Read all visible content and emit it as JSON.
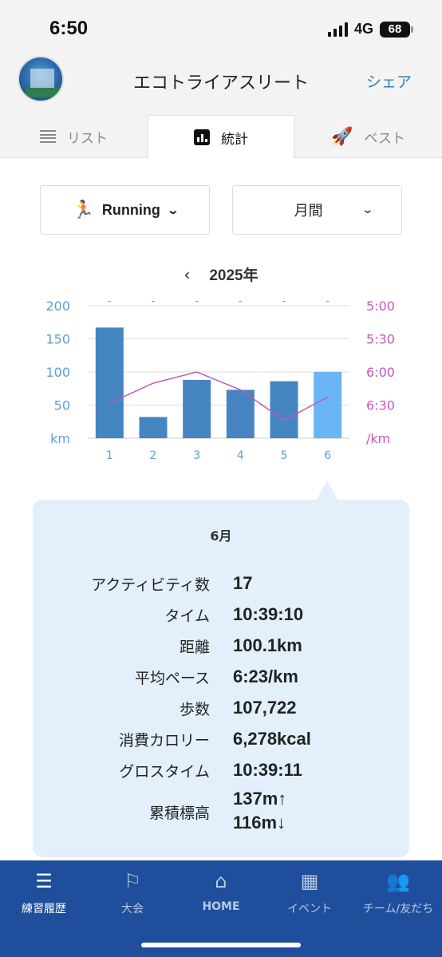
{
  "status_bar": {
    "time": "6:50",
    "network": "4G",
    "battery": "68"
  },
  "header": {
    "title": "エコトライアスリート",
    "share_label": "シェア"
  },
  "tabs": [
    {
      "label": "リスト",
      "icon": "list-icon"
    },
    {
      "label": "統計",
      "icon": "bar-chart-icon"
    },
    {
      "label": "ベスト",
      "icon": "rocket-icon"
    }
  ],
  "filters": {
    "sport": "Running",
    "period": "月間"
  },
  "year": {
    "label": "2025年"
  },
  "chart_data": {
    "type": "bar",
    "categories": [
      "1",
      "2",
      "3",
      "4",
      "5",
      "6"
    ],
    "series": [
      {
        "values": [
          167,
          32,
          88,
          73,
          86,
          100.1
        ],
        "axis": "left"
      },
      {
        "values": [
          6.47,
          6.17,
          6.0,
          6.27,
          6.73,
          6.38
        ],
        "axis": "right"
      }
    ],
    "left_axis": {
      "ticks": [
        "200",
        "150",
        "100",
        "50"
      ],
      "unit": "km",
      "range": [
        0,
        200
      ]
    },
    "right_axis": {
      "ticks": [
        "5:00",
        "5:30",
        "6:00",
        "6:30"
      ],
      "unit": "/km",
      "range_minutes": [
        5.0,
        7.0
      ]
    },
    "highlighted_category": "6",
    "colors": {
      "bar": "#4585c2",
      "bar_highlight": "#6bb4f5",
      "pace_line": "#c657b8",
      "left_axis": "#5aa0d8",
      "right_axis": "#c657b8"
    }
  },
  "details": {
    "month": "6月",
    "rows": [
      {
        "label": "アクティビティ数",
        "value": "17"
      },
      {
        "label": "タイム",
        "value": "10:39:10"
      },
      {
        "label": "距離",
        "value": "100.1km"
      },
      {
        "label": "平均ペース",
        "value": "6:23/km"
      },
      {
        "label": "歩数",
        "value": "107,722"
      },
      {
        "label": "消費カロリー",
        "value": "6,278kcal"
      },
      {
        "label": "グロスタイム",
        "value": "10:39:11"
      },
      {
        "label": "累積標高",
        "value": "137m↑",
        "value2": "116m↓"
      }
    ]
  },
  "bottom_nav": [
    {
      "label": "練習履歴",
      "icon": "list-icon"
    },
    {
      "label": "大会",
      "icon": "flag-icon"
    },
    {
      "label": "HOME",
      "icon": "home-icon"
    },
    {
      "label": "イベント",
      "icon": "map-icon"
    },
    {
      "label": "チーム/友だち",
      "icon": "people-icon"
    }
  ]
}
